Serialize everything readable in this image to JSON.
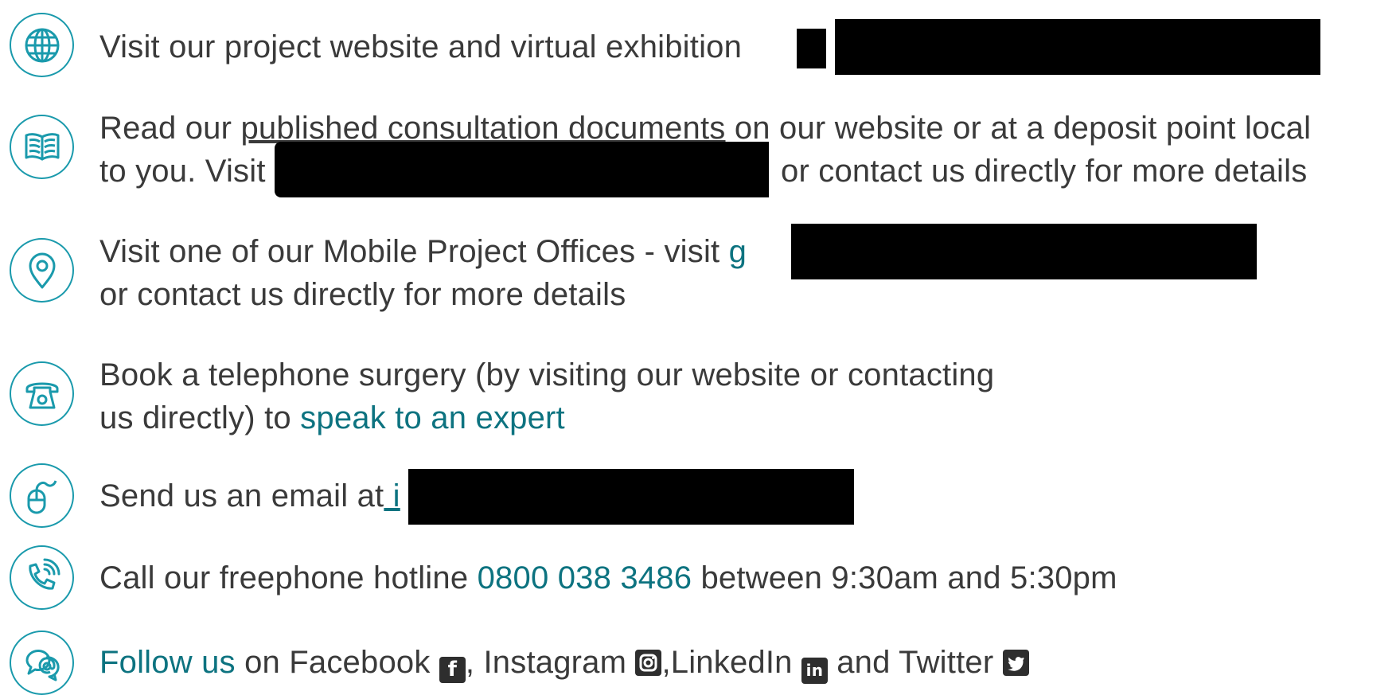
{
  "items": [
    {
      "icon": "globe-icon",
      "lines": [
        "Visit our project website and virtual exhibition"
      ]
    },
    {
      "icon": "open-book-icon",
      "line1_pre": "Read our ",
      "line1_link": "published consultation documents",
      "line1_post": " on our website or at a deposit point local",
      "line2_pre": "to you. Visit",
      "line2_post": "or contact us directly for more details"
    },
    {
      "icon": "location-pin-icon",
      "line1_pre": "Visit one of our Mobile Project Offices - visit ",
      "line1_link": "g",
      "line2": "or contact us directly for more details"
    },
    {
      "icon": "telephone-icon",
      "line1": "Book a telephone surgery (by visiting our website or contacting",
      "line2_pre": "us directly) to ",
      "line2_link": "speak to an expert"
    },
    {
      "icon": "mouse-icon",
      "pre": "Send us an email at",
      "link": " i"
    },
    {
      "icon": "phone-call-icon",
      "pre": "Call our freephone hotline ",
      "number": "0800 038 3486",
      "post": " between 9:30am and 5:30pm"
    },
    {
      "icon": "chat-bubbles-icon",
      "follow": "Follow us",
      "p1": " on Facebook ",
      "p2": ", Instagram ",
      "p3": ",LinkedIn ",
      "p4": " and Twitter ",
      "fb_glyph": "f",
      "li_glyph": "in"
    }
  ]
}
